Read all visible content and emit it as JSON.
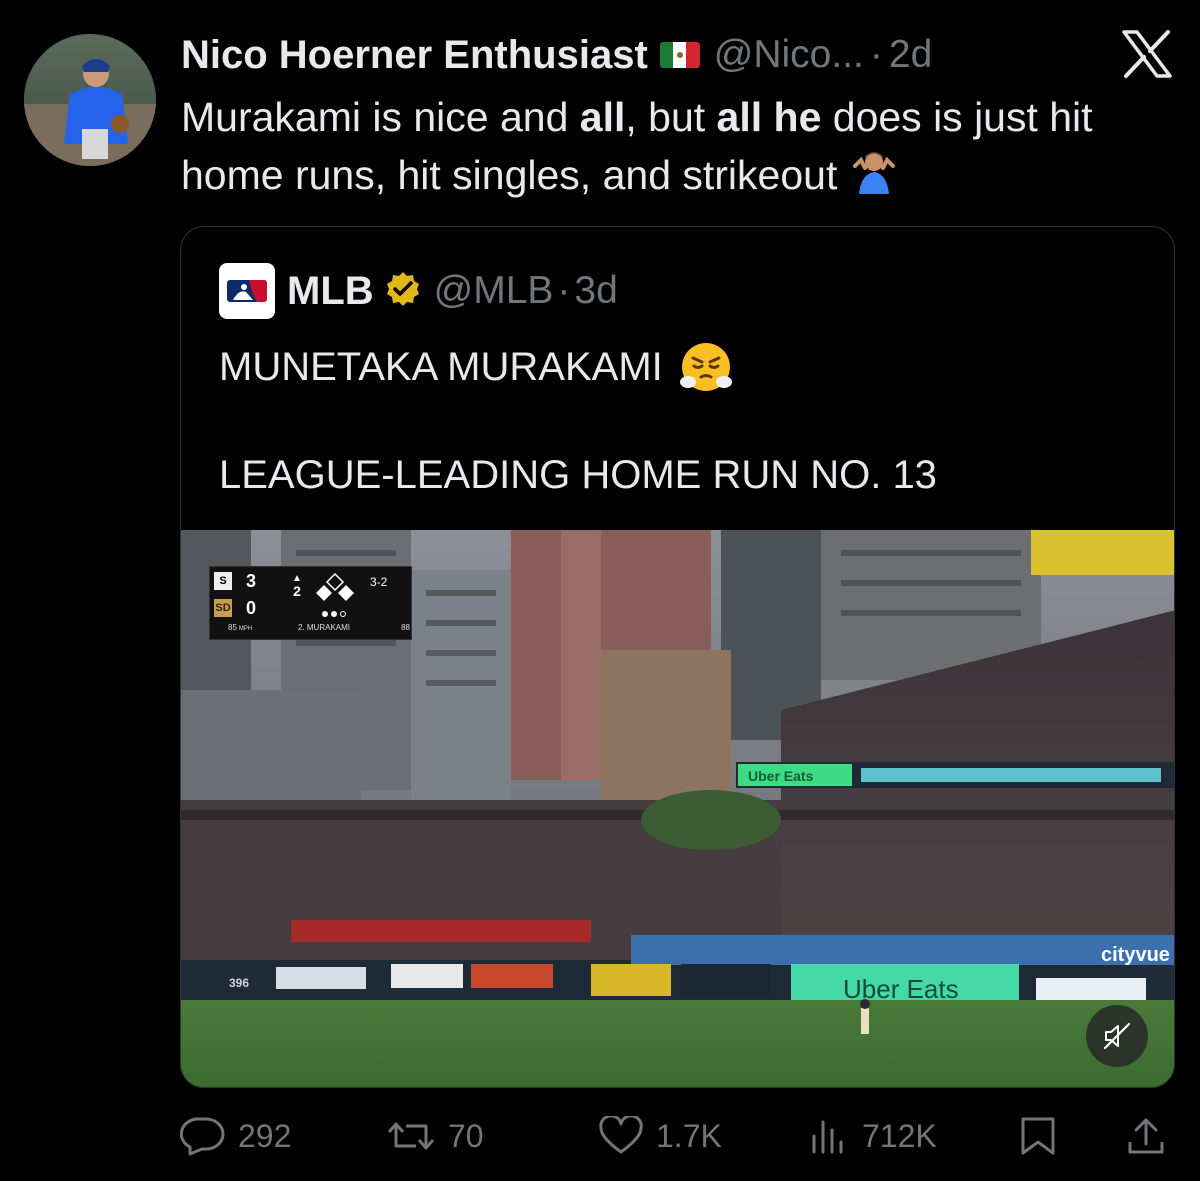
{
  "tweet": {
    "author_name": "Nico Hoerner Enthusiast",
    "handle": "@Nico...",
    "separator": "·",
    "time": "2d",
    "text_parts": [
      "Murakami is nice and ",
      "all",
      ", but ",
      "all he",
      " does is just hit home runs, hit singles, and strikeout"
    ],
    "flag_icon": "mexico-flag-icon",
    "emoji": "man-shrugging-emoji"
  },
  "quote": {
    "author_name": "MLB",
    "handle": "@MLB",
    "separator": "·",
    "time": "3d",
    "line1": "MUNETAKA MURAKAMI",
    "emoji": "face-with-steam-emoji",
    "line2": "LEAGUE-LEADING HOME RUN NO. 13",
    "verified_icon": "gold-verified-badge-icon",
    "logo_icon": "mlb-logo-icon"
  },
  "scorebug": {
    "away_score": "3",
    "home_score": "0",
    "inning": "2",
    "count": "3-2",
    "pitch_speed": "85",
    "pitch_unit": "MPH",
    "batter": "2. MURAKAMI",
    "pitch_count": "88"
  },
  "video_signage": {
    "sponsor_1": "Uber Eats",
    "sponsor_2": "Uber Eats",
    "distance_marker": "396",
    "city_sign": "cityvue"
  },
  "actions": {
    "replies": "292",
    "reposts": "70",
    "likes": "1.7K",
    "views": "712K"
  },
  "colors": {
    "background": "#000000",
    "text_primary": "#e7e9ea",
    "text_secondary": "#71767b",
    "border": "#2f3336",
    "verified_gold": "#e2b719"
  }
}
